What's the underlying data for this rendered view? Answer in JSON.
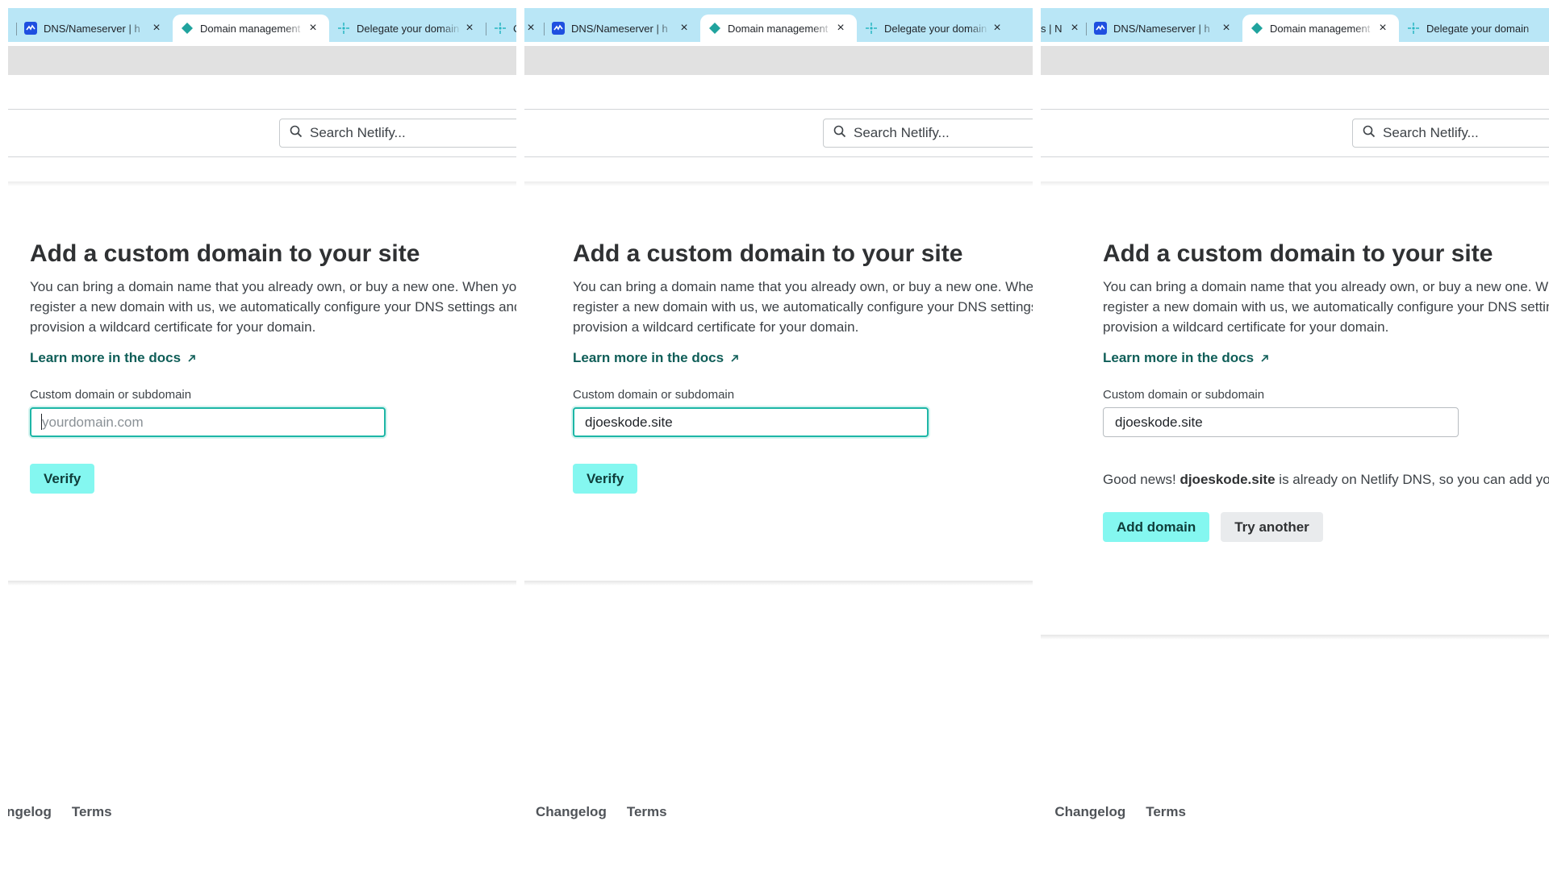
{
  "tabs": [
    {
      "title": "DNS/Nameserver | h",
      "icon": "domain-registrar-icon"
    },
    {
      "title": "Domain management",
      "icon": "netlify-icon"
    },
    {
      "title": "Delegate your domain",
      "icon": "netlify-docs-icon"
    },
    {
      "title": "C",
      "icon": "netlify-docs-icon"
    }
  ],
  "panel3_leading_tab_text": "s | N",
  "search": {
    "placeholder": "Search Netlify..."
  },
  "page": {
    "title": "Add a custom domain to your site",
    "description": "You can bring a domain name that you already own, or buy a new one. When you register a new domain with us, we automatically configure your DNS settings and provision a wildcard certificate for your domain.",
    "docs_link": "Learn more in the docs",
    "field_label": "Custom domain or subdomain",
    "input_placeholder": "yourdomain.com",
    "verify_label": "Verify"
  },
  "panels": [
    {
      "input_value": ""
    },
    {
      "input_value": "djoeskode.site"
    },
    {
      "input_value": "djoeskode.site"
    }
  ],
  "result": {
    "prefix": "Good news! ",
    "domain": "djoeskode.site",
    "suffix": " is already on Netlify DNS, so you can add your domain right away.",
    "add_label": "Add domain",
    "try_label": "Try another"
  },
  "footer": {
    "changelog": "Changelog",
    "terms": "Terms"
  },
  "colors": {
    "tab_strip": "#b9e6f6",
    "accent": "#84f7f0",
    "link": "#0f5e58",
    "focus": "#1db6a6"
  }
}
